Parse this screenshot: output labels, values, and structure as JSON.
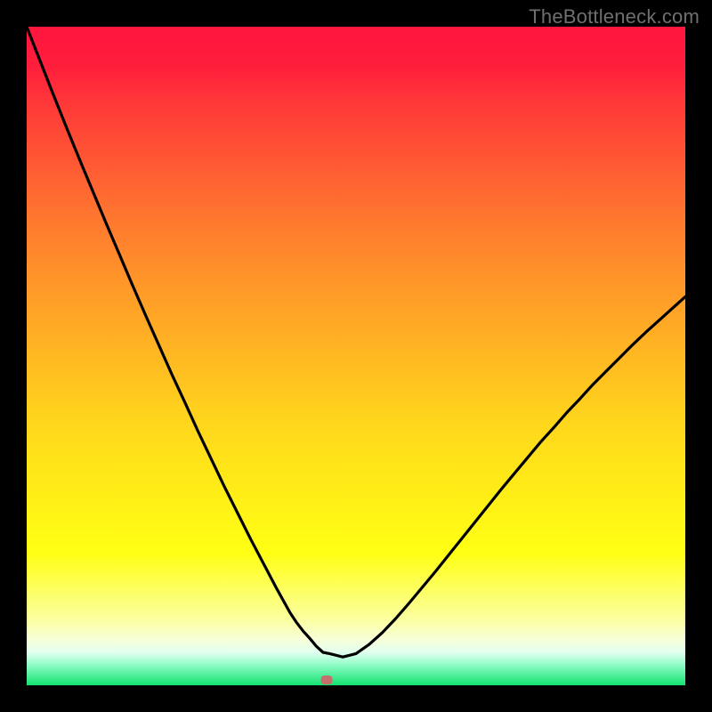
{
  "watermark": "TheBottleneck.com",
  "marker": {
    "x_frac": 0.455,
    "y_frac": 0.992
  },
  "chart_data": {
    "type": "line",
    "title": "",
    "xlabel": "",
    "ylabel": "",
    "xlim": [
      0,
      100
    ],
    "ylim": [
      0,
      100
    ],
    "x": [
      0,
      2,
      4,
      6,
      8,
      10,
      12,
      14,
      16,
      18,
      20,
      22,
      24,
      26,
      28,
      30,
      32,
      34,
      36,
      38,
      40,
      41,
      42,
      43,
      44,
      45,
      46,
      48,
      50,
      52,
      54,
      56,
      58,
      60,
      62,
      64,
      66,
      68,
      70,
      72,
      74,
      76,
      78,
      80,
      82,
      84,
      86,
      88,
      90,
      92,
      94,
      96,
      98,
      100
    ],
    "values": [
      100,
      94.9,
      89.8,
      84.8,
      79.9,
      75.1,
      70.3,
      65.6,
      60.9,
      56.3,
      51.8,
      47.3,
      43.0,
      38.6,
      34.4,
      30.2,
      26.2,
      22.2,
      18.4,
      14.6,
      11.0,
      9.5,
      8.2,
      7.1,
      5.9,
      5.0,
      4.8,
      4.3,
      4.8,
      6.2,
      8.0,
      10.1,
      12.4,
      14.8,
      17.2,
      19.7,
      22.2,
      24.7,
      27.2,
      29.7,
      32.1,
      34.5,
      36.9,
      39.1,
      41.4,
      43.5,
      45.7,
      47.7,
      49.7,
      51.7,
      53.6,
      55.4,
      57.2,
      59.0
    ],
    "grid": false,
    "legend": false
  },
  "colors": {
    "curve": "#000000",
    "marker": "#c76e6e",
    "background_top": "#ff153d",
    "background_bottom": "#13e26f",
    "frame": "#000000"
  }
}
